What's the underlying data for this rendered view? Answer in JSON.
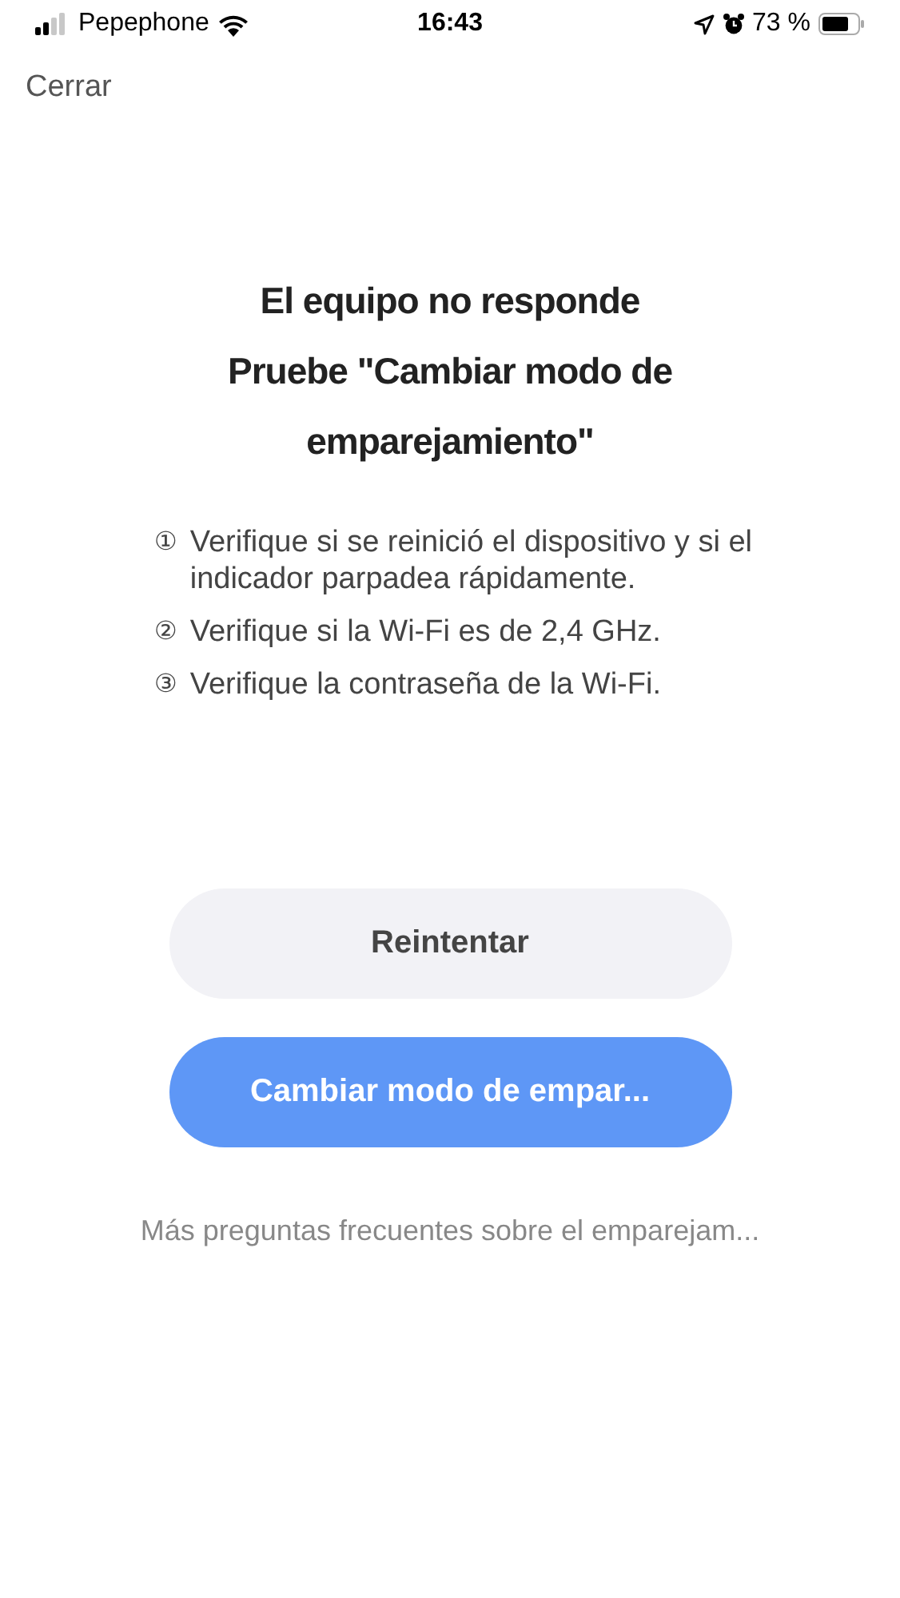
{
  "status_bar": {
    "carrier": "Pepephone",
    "time": "16:43",
    "battery": "73 %"
  },
  "close_link": "Cerrar",
  "title": [
    "El equipo no responde",
    "Pruebe \"Cambiar modo de emparejamiento\""
  ],
  "steps": [
    {
      "marker": "①",
      "text": "Verifique si se reinició el dispositivo y si el indicador parpadea rápidamente."
    },
    {
      "marker": "②",
      "text": "Verifique si la Wi-Fi es de 2,4 GHz."
    },
    {
      "marker": "③",
      "text": "Verifique la contraseña de la Wi-Fi."
    }
  ],
  "buttons": [
    {
      "label": "Reintentar",
      "kind": "secondary"
    },
    {
      "label": "Cambiar modo de empar...",
      "kind": "primary"
    }
  ],
  "faq_link": "Más preguntas frecuentes sobre el emparejam..."
}
